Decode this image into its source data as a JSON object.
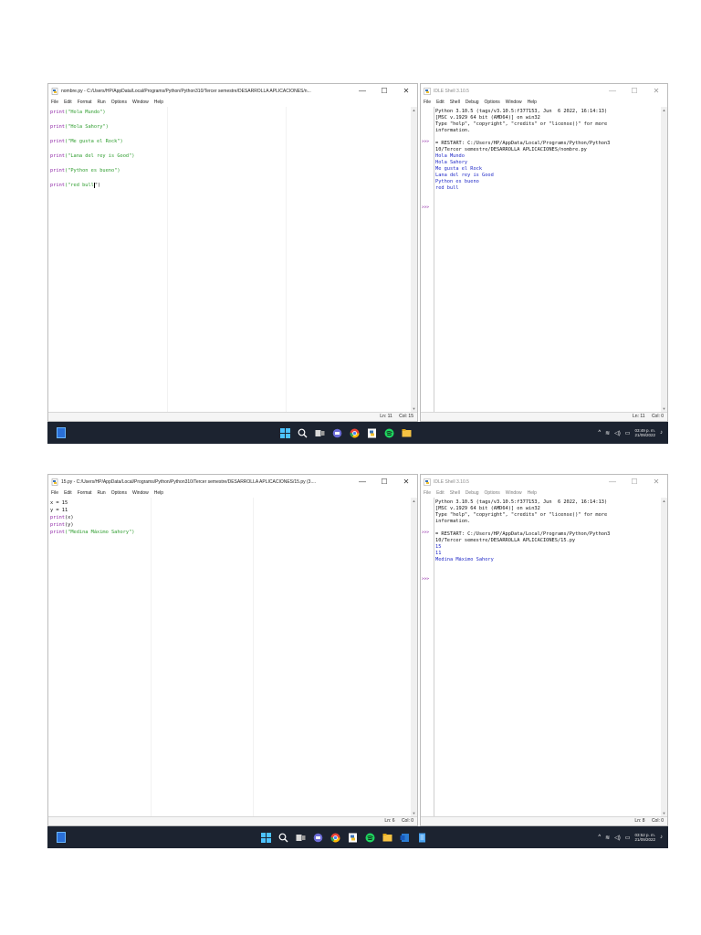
{
  "screenshots": [
    {
      "editor": {
        "title": "nombre.py - C:/Users/HP/AppData/Local/Programs/Python/Python310/Tercer semestre/DESARROLLA APLICACIONES/n...",
        "controls": {
          "minimize": "—",
          "maximize": "☐",
          "close": "✕"
        },
        "menu": [
          "File",
          "Edit",
          "Format",
          "Run",
          "Options",
          "Window",
          "Help"
        ],
        "code": [
          {
            "pre": "",
            "fn": "print",
            "str": "(\"Hola Mundo\")",
            "post": ""
          },
          {
            "pre": "",
            "fn": "",
            "str": "",
            "post": ""
          },
          {
            "pre": "",
            "fn": "print",
            "str": "(\"Hola Sahory\")",
            "post": ""
          },
          {
            "pre": "",
            "fn": "",
            "str": "",
            "post": ""
          },
          {
            "pre": "",
            "fn": "print",
            "str": "(\"Me gusta el Rock\")",
            "post": ""
          },
          {
            "pre": "",
            "fn": "",
            "str": "",
            "post": ""
          },
          {
            "pre": "",
            "fn": "print",
            "str": "(\"Lana del rey is Good\")",
            "post": ""
          },
          {
            "pre": "",
            "fn": "",
            "str": "",
            "post": ""
          },
          {
            "pre": "",
            "fn": "print",
            "str": "(\"Python es bueno\")",
            "post": ""
          },
          {
            "pre": "",
            "fn": "",
            "str": "",
            "post": ""
          },
          {
            "pre": "",
            "fn": "print",
            "str": "(\"red bull",
            "post": "\")",
            "cursor": true
          }
        ],
        "status": {
          "ln": "Ln: 11",
          "col": "Col: 15"
        }
      },
      "shell": {
        "title": "IDLE Shell 3.10.5",
        "controls": {
          "minimize": "—",
          "maximize": "☐",
          "close": "✕"
        },
        "menu": [
          "File",
          "Edit",
          "Shell",
          "Debug",
          "Options",
          "Window",
          "Help"
        ],
        "lines": [
          {
            "text": "Python 3.10.5 (tags/v3.10.5:f377153, Jun  6 2022, 16:14:13)",
            "kind": "info"
          },
          {
            "text": "[MSC v.1929 64 bit (AMD64)] on win32",
            "kind": "info"
          },
          {
            "text": "Type \"help\", \"copyright\", \"credits\" or \"license()\" for more",
            "kind": "info"
          },
          {
            "text": "information.",
            "kind": "info"
          },
          {
            "text": "",
            "kind": "info"
          },
          {
            "text": "= RESTART: C:/Users/HP/AppData/Local/Programs/Python/Python3",
            "kind": "info"
          },
          {
            "text": "10/Tercer semestre/DESARROLLA APLICACIONES/nombre.py",
            "kind": "info"
          },
          {
            "text": "Hola Mundo",
            "kind": "out"
          },
          {
            "text": "Hola Sahory",
            "kind": "out"
          },
          {
            "text": "Me gusta el Rock",
            "kind": "out"
          },
          {
            "text": "Lana del rey is Good",
            "kind": "out"
          },
          {
            "text": "Python es bueno",
            "kind": "out"
          },
          {
            "text": "red bull",
            "kind": "out"
          }
        ],
        "prompts": [
          ">>>",
          ">>>"
        ],
        "status": {
          "ln": "Ln: 11",
          "col": "Col: 0"
        }
      },
      "taskbar": {
        "time": "03:49 p. m.",
        "date": "21/09/2022"
      }
    },
    {
      "editor": {
        "title": "15.py - C:/Users/HP/AppData/Local/Programs/Python/Python310/Tercer semestre/DESARROLLA APLICACIONES/15.py (3....",
        "controls": {
          "minimize": "—",
          "maximize": "☐",
          "close": "✕"
        },
        "menu": [
          "File",
          "Edit",
          "Format",
          "Run",
          "Options",
          "Window",
          "Help"
        ],
        "code": [
          {
            "pre": "x = 15",
            "fn": "",
            "str": "",
            "post": ""
          },
          {
            "pre": "y = 11",
            "fn": "",
            "str": "",
            "post": ""
          },
          {
            "pre": "",
            "fn": "print",
            "str": "",
            "post": "(x)"
          },
          {
            "pre": "",
            "fn": "print",
            "str": "",
            "post": "(y)"
          },
          {
            "pre": "",
            "fn": "print",
            "str": "(\"Medina Máximo Sahory\")",
            "post": ""
          }
        ],
        "status": {
          "ln": "Ln: 6",
          "col": "Col: 0"
        }
      },
      "shell": {
        "title": "IDLE Shell 3.10.5",
        "controls": {
          "minimize": "—",
          "maximize": "☐",
          "close": "✕"
        },
        "menu": [
          "File",
          "Edit",
          "Shell",
          "Debug",
          "Options",
          "Window",
          "Help"
        ],
        "lines": [
          {
            "text": "Python 3.10.5 (tags/v3.10.5:f377153, Jun  6 2022, 16:14:13)",
            "kind": "info"
          },
          {
            "text": "[MSC v.1929 64 bit (AMD64)] on win32",
            "kind": "info"
          },
          {
            "text": "Type \"help\", \"copyright\", \"credits\" or \"license()\" for more",
            "kind": "info"
          },
          {
            "text": "information.",
            "kind": "info"
          },
          {
            "text": "",
            "kind": "info"
          },
          {
            "text": "= RESTART: C:/Users/HP/AppData/Local/Programs/Python/Python3",
            "kind": "info"
          },
          {
            "text": "10/Tercer semestre/DESARROLLA APLICACIONES/15.py",
            "kind": "info"
          },
          {
            "text": "15",
            "kind": "out"
          },
          {
            "text": "11",
            "kind": "out"
          },
          {
            "text": "Medina Máximo Sahory",
            "kind": "out"
          }
        ],
        "prompts": [
          ">>>",
          ">>>"
        ],
        "status": {
          "ln": "Ln: 8",
          "col": "Col: 0"
        }
      },
      "taskbar": {
        "time": "03:52 p. m.",
        "date": "21/09/2022"
      }
    }
  ],
  "colors": {
    "taskbar": "#1c2330",
    "keyword": "#8b1fa3",
    "string": "#2c9c2c",
    "output": "#1f28c7"
  },
  "icons": [
    "python-file-icon",
    "windows-start-icon",
    "search-icon",
    "task-view-icon",
    "chat-icon",
    "chrome-icon",
    "idle-icon",
    "spotify-icon",
    "file-explorer-icon",
    "word-icon",
    "notepad-icon",
    "wifi-icon",
    "volume-icon",
    "battery-icon"
  ]
}
